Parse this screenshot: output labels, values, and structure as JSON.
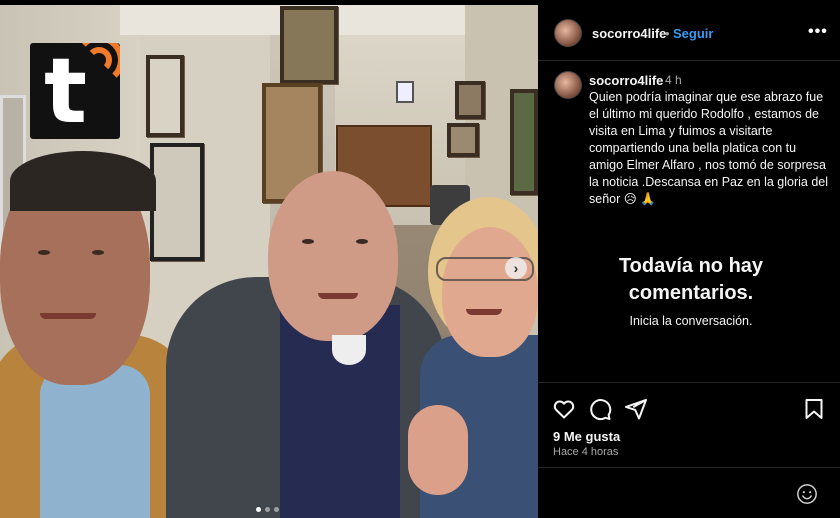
{
  "post": {
    "username": "socorro4life",
    "follow_label": "Seguir",
    "separator": "•",
    "more_label": "•••",
    "time": "4 h",
    "caption": "Quien podría imaginar que ese abrazo fue el último mi querido Rodolfo , estamos de visita en Lima y fuimos a visitarte compartiendo una bella platica con tu amigo Elmer Alfaro , nos tomó de sorpresa la noticia .Descansa en Paz en la gloria del señor 😥 🙏"
  },
  "comments": {
    "empty_title": "Todavía no hay comentarios.",
    "empty_subtitle": "Inicia la conversación."
  },
  "actions": {
    "icons": [
      "heart-icon",
      "comment-icon",
      "share-icon",
      "bookmark-icon"
    ],
    "likes": "9 Me gusta",
    "posted": "Hace 4 horas"
  },
  "carousel": {
    "next_label": "›",
    "slides": 3,
    "active_slide": 1
  },
  "logo": {
    "letter": "t",
    "accent": "#f07a2a"
  },
  "colors": {
    "background": "#000000",
    "link": "#3a9bf0",
    "muted": "#a8a8a8"
  }
}
